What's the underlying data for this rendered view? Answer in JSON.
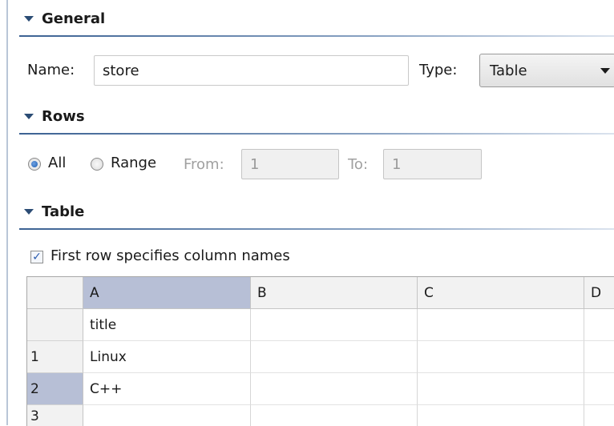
{
  "general": {
    "title": "General",
    "name_label": "Name:",
    "name_value": "store",
    "type_label": "Type:",
    "type_value": "Table"
  },
  "rows": {
    "title": "Rows",
    "all_label": "All",
    "range_label": "Range",
    "from_label": "From:",
    "from_value": "1",
    "to_label": "To:",
    "to_value": "1",
    "selected": "All"
  },
  "table": {
    "title": "Table",
    "first_row_label": "First row specifies column names",
    "first_row_checked": true,
    "columns": [
      "A",
      "B",
      "C",
      "D"
    ],
    "selected_column": "A",
    "rows": [
      {
        "header": "",
        "cells": [
          "title",
          "",
          "",
          ""
        ]
      },
      {
        "header": "1",
        "cells": [
          "Linux",
          "",
          "",
          ""
        ]
      },
      {
        "header": "2",
        "cells": [
          "C++",
          "",
          "",
          ""
        ]
      },
      {
        "header": "3",
        "cells": [
          "",
          "",
          "",
          ""
        ]
      }
    ],
    "selected_row": "2"
  },
  "icons": {
    "collapse": "triangle-down-icon",
    "dropdown": "chevron-down-icon",
    "check": "check-icon"
  },
  "colors": {
    "accent": "#2b4c74",
    "selection": "#b7bfd6"
  }
}
